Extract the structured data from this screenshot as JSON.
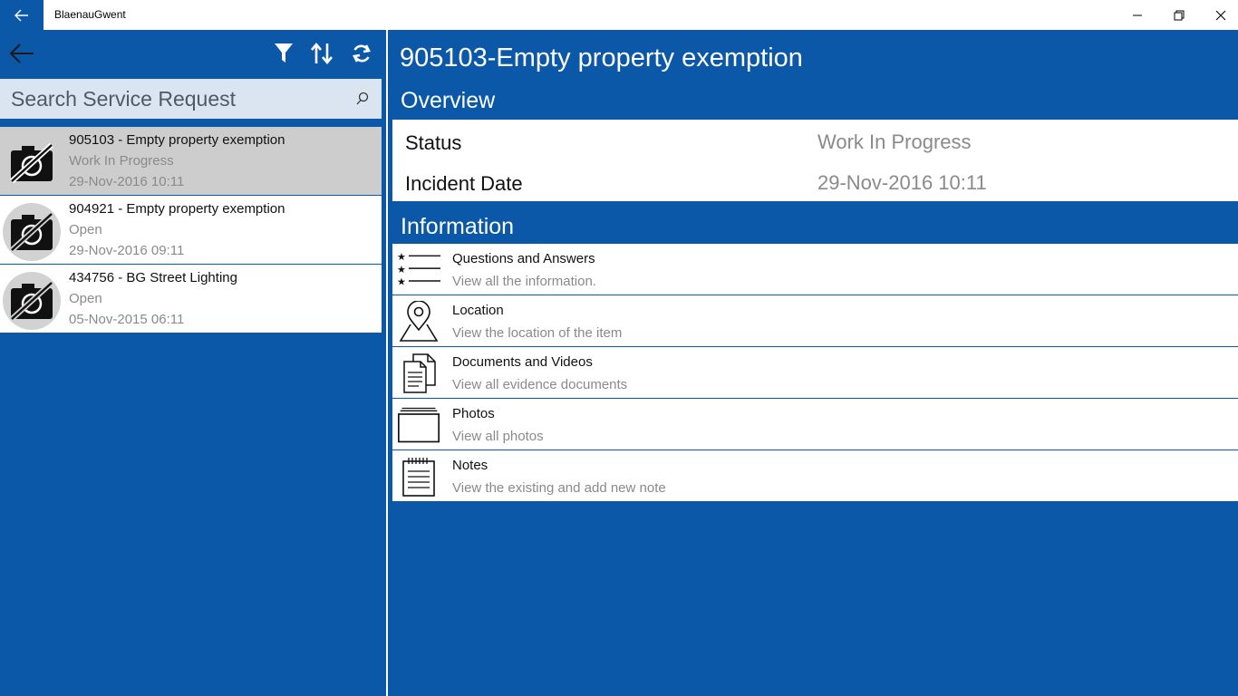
{
  "app": {
    "title": "BlaenauGwent",
    "icons": {
      "back": "arrow-left-icon",
      "minimize": "minimize-icon",
      "maximize": "restore-icon",
      "close": "close-icon"
    }
  },
  "colors": {
    "accent": "#0b57a8",
    "search_bg": "#dbe5f1",
    "selected_bg": "#cdcdcd",
    "muted_text": "#8a8a8a"
  },
  "left_panel": {
    "toolbar_icons": [
      "arrow-left-icon",
      "filter-icon",
      "sort-icon",
      "refresh-icon"
    ],
    "search": {
      "placeholder": "Search Service Request",
      "icon": "search-icon"
    },
    "requests": [
      {
        "title": "905103 - Empty property exemption",
        "status": "Work In Progress",
        "date": "29-Nov-2016 10:11",
        "selected": true,
        "icon": "no-photo-icon"
      },
      {
        "title": "904921 - Empty property exemption",
        "status": "Open",
        "date": "29-Nov-2016 09:11",
        "selected": false,
        "icon": "no-photo-icon"
      },
      {
        "title": "434756 - BG Street Lighting",
        "status": "Open",
        "date": "05-Nov-2015 06:11",
        "selected": false,
        "icon": "no-photo-icon"
      }
    ]
  },
  "detail": {
    "title": "905103-Empty property exemption",
    "overview": {
      "heading": "Overview",
      "status_label": "Status",
      "status_value": "Work In Progress",
      "incident_label": "Incident Date",
      "incident_value": "29-Nov-2016 10:11"
    },
    "information": {
      "heading": "Information",
      "items": [
        {
          "title": "Questions and Answers",
          "subtitle": "View all the information.",
          "icon": "star-list-icon"
        },
        {
          "title": "Location",
          "subtitle": "View the location of the item",
          "icon": "map-pin-icon"
        },
        {
          "title": "Documents and Videos",
          "subtitle": "View all evidence documents",
          "icon": "documents-icon"
        },
        {
          "title": "Photos",
          "subtitle": "View all photos",
          "icon": "photos-icon"
        },
        {
          "title": "Notes",
          "subtitle": "View the existing and add new note",
          "icon": "notepad-icon"
        }
      ]
    }
  }
}
